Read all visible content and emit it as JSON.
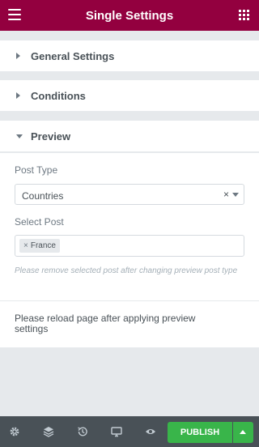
{
  "header": {
    "title": "Single Settings",
    "menu_icon": "hamburger-icon",
    "apps_icon": "grid-icon"
  },
  "sections": {
    "general": {
      "label": "General Settings"
    },
    "conditions": {
      "label": "Conditions"
    },
    "preview": {
      "label": "Preview"
    }
  },
  "preview": {
    "post_type_label": "Post Type",
    "post_type_value": "Countries",
    "post_type_clear": "×",
    "select_post_label": "Select Post",
    "selected_tags": [
      "France"
    ],
    "tag_remove": "×",
    "note": "Please remove selected post after changing preview post type",
    "reload_text": "Please reload page after applying preview settings"
  },
  "footer": {
    "icons": [
      "gear-icon",
      "layers-icon",
      "history-icon",
      "desktop-icon",
      "eye-icon"
    ],
    "publish_label": "PUBLISH"
  },
  "colors": {
    "brand": "#93003f",
    "publish": "#39b54a",
    "footer": "#495157"
  }
}
